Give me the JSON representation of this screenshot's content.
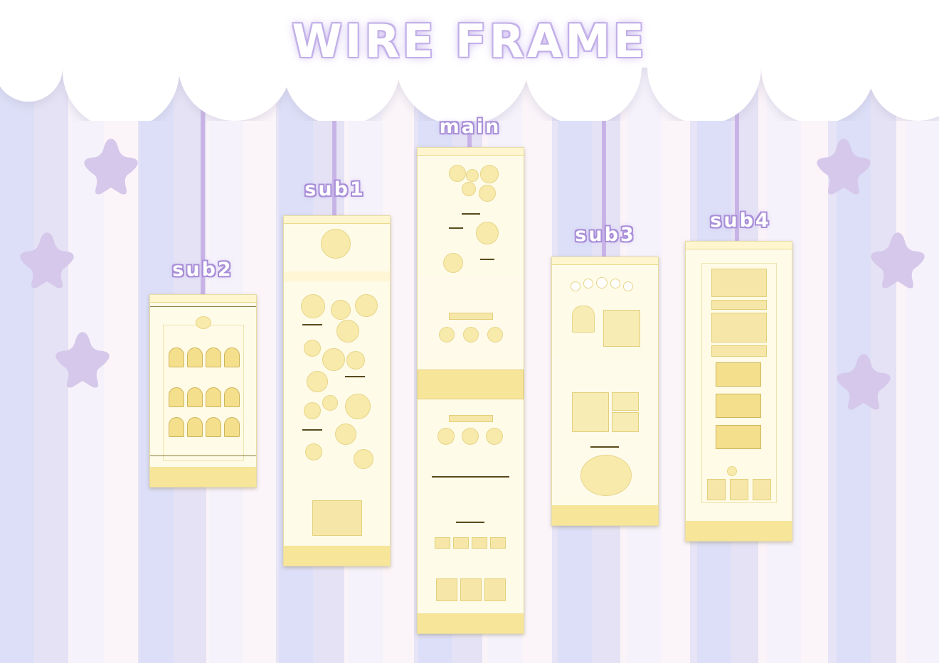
{
  "title": "WIRE FRAME",
  "frames": [
    {
      "label": "sub2"
    },
    {
      "label": "sub1"
    },
    {
      "label": "main"
    },
    {
      "label": "sub3"
    },
    {
      "label": "sub4"
    }
  ],
  "colors": {
    "title_glow": "#c9b7ee",
    "label_outline": "#a98fd8",
    "string": "#c8b3e6",
    "star": "#d5c8ea",
    "frame_bg": "#fefbe8",
    "frame_accent": "#f7e59a"
  }
}
